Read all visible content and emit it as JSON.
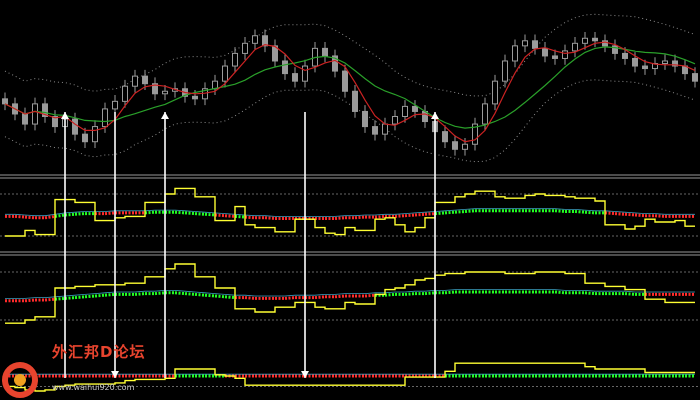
{
  "colors": {
    "background": "#000000",
    "candle": "#9a9a9a",
    "band": "#8a8a8a",
    "ma_fast": "#cc2222",
    "ma_slow": "#2aa02a",
    "oscillator": "#ffff33",
    "signal_red": "#ff2a2a",
    "signal_green": "#22ff22",
    "zero_line": "#3aa0c0",
    "level": "#888888",
    "arrow": "#ffffff",
    "separator": "#cccccc"
  },
  "watermark": {
    "text": "外汇邦D论坛",
    "url": "www.waihui920.com"
  },
  "chart_data": [
    {
      "type": "candlestick",
      "name": "price",
      "note_overlays": [
        "upper band",
        "lower band",
        "fast moving average",
        "slow moving average"
      ],
      "close": [
        -6,
        -14,
        -22,
        -6,
        -16,
        -24,
        -18,
        -30,
        -36,
        -24,
        -10,
        -4,
        8,
        16,
        10,
        2,
        4,
        6,
        0,
        -2,
        6,
        12,
        24,
        34,
        42,
        48,
        40,
        28,
        18,
        12,
        24,
        38,
        32,
        20,
        4,
        -12,
        -24,
        -30,
        -22,
        -16,
        -8,
        -12,
        -20,
        -28,
        -36,
        -42,
        -38,
        -22,
        -6,
        12,
        28,
        40,
        44,
        38,
        32,
        30,
        36,
        42,
        46,
        44,
        40,
        34,
        30,
        24,
        22,
        26,
        28,
        24,
        18,
        12
      ],
      "arrows_at_index": [
        6,
        11,
        16,
        30,
        43
      ],
      "grid": false,
      "legend": "none"
    },
    {
      "type": "line",
      "name": "oscillator-1",
      "series": [
        {
          "role": "step",
          "values": [
            -30,
            -30,
            -22,
            -28,
            -28,
            22,
            22,
            18,
            18,
            -8,
            -8,
            -4,
            -2,
            -2,
            18,
            18,
            30,
            38,
            38,
            26,
            26,
            -8,
            -8,
            12,
            -14,
            -18,
            -18,
            -24,
            -24,
            -6,
            -6,
            -18,
            -26,
            -28,
            -18,
            -22,
            -22,
            -6,
            -4,
            -14,
            -24,
            -18,
            -4,
            18,
            18,
            26,
            30,
            34,
            34,
            26,
            24,
            24,
            28,
            30,
            28,
            28,
            26,
            24,
            24,
            20,
            -14,
            -14,
            -20,
            -16,
            -6,
            -10,
            -10,
            -8,
            -16,
            -16
          ]
        },
        {
          "role": "signal",
          "values": [
            -2,
            -2,
            -3,
            -4,
            -4,
            -2,
            0,
            1,
            2,
            2,
            2,
            3,
            3,
            3,
            3,
            4,
            4,
            4,
            3,
            2,
            1,
            0,
            -1,
            -2,
            -3,
            -4,
            -4,
            -5,
            -5,
            -5,
            -5,
            -5,
            -5,
            -5,
            -4,
            -4,
            -3,
            -3,
            -2,
            -2,
            -1,
            0,
            1,
            2,
            3,
            4,
            5,
            6,
            6,
            6,
            6,
            6,
            6,
            6,
            6,
            6,
            5,
            5,
            4,
            3,
            3,
            2,
            1,
            0,
            -1,
            -1,
            -2,
            -2,
            -2,
            -2
          ]
        }
      ],
      "ylim": [
        -50,
        50
      ],
      "levels": [
        30,
        -30
      ]
    },
    {
      "type": "line",
      "name": "oscillator-2",
      "series": [
        {
          "role": "step",
          "values": [
            -34,
            -34,
            -30,
            -26,
            -26,
            10,
            10,
            12,
            12,
            14,
            14,
            14,
            16,
            16,
            24,
            24,
            34,
            40,
            40,
            24,
            24,
            10,
            10,
            -16,
            -16,
            -20,
            -20,
            -14,
            -14,
            -8,
            -8,
            -14,
            -16,
            -16,
            -8,
            -10,
            -10,
            2,
            8,
            10,
            14,
            20,
            22,
            26,
            28,
            28,
            30,
            30,
            30,
            30,
            28,
            28,
            28,
            30,
            30,
            30,
            28,
            28,
            16,
            16,
            12,
            12,
            8,
            8,
            -4,
            -4,
            -8,
            -8,
            -8,
            -8
          ]
        },
        {
          "role": "signal",
          "values": [
            -6,
            -6,
            -6,
            -5,
            -5,
            -4,
            -3,
            -2,
            -1,
            0,
            1,
            2,
            2,
            2,
            3,
            3,
            4,
            4,
            3,
            2,
            1,
            0,
            -1,
            -2,
            -2,
            -3,
            -3,
            -3,
            -3,
            -2,
            -2,
            -2,
            -1,
            -1,
            0,
            0,
            0,
            1,
            1,
            2,
            2,
            3,
            3,
            4,
            4,
            5,
            5,
            5,
            5,
            5,
            5,
            5,
            5,
            5,
            5,
            5,
            4,
            4,
            4,
            3,
            3,
            3,
            3,
            2,
            2,
            2,
            2,
            2,
            2,
            2
          ]
        }
      ],
      "ylim": [
        -50,
        50
      ],
      "levels": [
        30,
        -30
      ]
    },
    {
      "type": "line",
      "name": "oscillator-3",
      "series": [
        {
          "role": "step",
          "values": [
            -30,
            -32,
            -36,
            -38,
            -36,
            -30,
            -28,
            -26,
            -26,
            -26,
            -26,
            -24,
            -20,
            -18,
            -18,
            -18,
            -16,
            0,
            0,
            0,
            0,
            -10,
            -12,
            -16,
            -28,
            -28,
            -28,
            -28,
            -28,
            -28,
            -28,
            -28,
            -28,
            -28,
            -28,
            -28,
            -28,
            -28,
            -28,
            -28,
            -14,
            -14,
            -14,
            -14,
            -4,
            10,
            10,
            10,
            10,
            10,
            10,
            10,
            10,
            10,
            10,
            10,
            10,
            10,
            4,
            0,
            0,
            0,
            0,
            0,
            -6,
            -6,
            -6,
            -6,
            -6,
            -6
          ]
        },
        {
          "role": "signal",
          "values": [
            -12,
            -12,
            -12,
            -12,
            -12,
            -12,
            -12,
            -12,
            -12,
            -12,
            -12,
            -12,
            -12,
            -12,
            -12,
            -12,
            -12,
            -12,
            -12,
            -12,
            -12,
            -12,
            -12,
            -12,
            -12,
            -12,
            -12,
            -12,
            -12,
            -12,
            -12,
            -12,
            -12,
            -12,
            -12,
            -12,
            -12,
            -12,
            -12,
            -12,
            -12,
            -12,
            -12,
            -12,
            -12,
            -12,
            -12,
            -12,
            -12,
            -12,
            -12,
            -12,
            -12,
            -12,
            -12,
            -12,
            -12,
            -12,
            -12,
            -12,
            -12,
            -12,
            -12,
            -12,
            -12,
            -12,
            -12,
            -12,
            -12,
            -12
          ]
        }
      ],
      "ylim": [
        -50,
        50
      ],
      "levels": [
        -30
      ]
    }
  ]
}
